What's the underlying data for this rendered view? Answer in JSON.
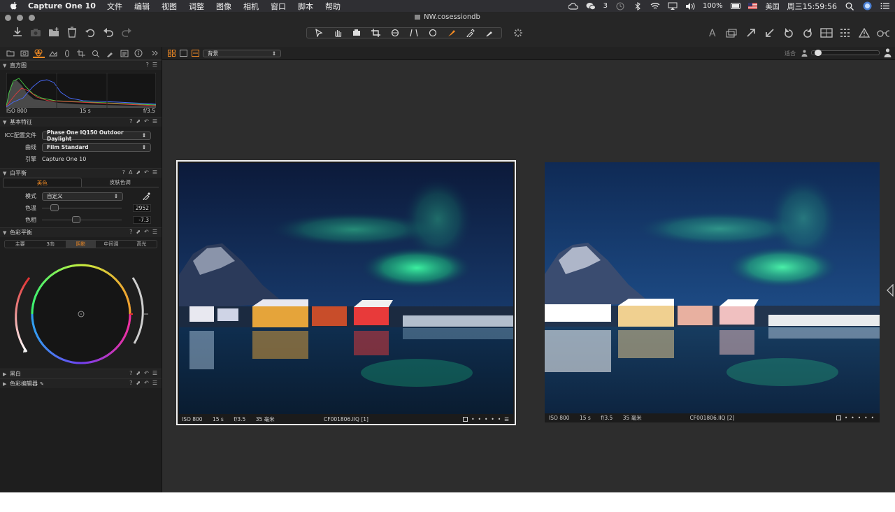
{
  "menubar": {
    "app_name": "Capture One 10",
    "menus": [
      "文件",
      "编辑",
      "视图",
      "调整",
      "图像",
      "相机",
      "窗口",
      "脚本",
      "帮助"
    ],
    "wechat_count": "3",
    "battery": "100%",
    "input_source": "美国",
    "datetime": "周三15:59:56"
  },
  "window": {
    "title": "NW.cosessiondb"
  },
  "viewer_bar": {
    "layout_select": "背景",
    "fit_label": "适合"
  },
  "histogram": {
    "title": "直方图",
    "iso": "ISO 800",
    "shutter": "15 s",
    "aperture": "f/3.5"
  },
  "basic": {
    "title": "基本特征",
    "icc_label": "ICC配置文件",
    "icc_value": "Phase One IQ150 Outdoor Daylight",
    "curve_label": "曲线",
    "curve_value": "Film Standard",
    "engine_label": "引擎",
    "engine_value": "Capture One 10"
  },
  "white_balance": {
    "title": "白平衡",
    "tabs": [
      "英色",
      "皮肤色调"
    ],
    "mode_label": "模式",
    "mode_value": "自定义",
    "kelvin_label": "色温",
    "kelvin_value": "2952",
    "tint_label": "色相",
    "tint_value": "-7.3"
  },
  "color_balance": {
    "title": "色彩平衡",
    "tabs": [
      "主要",
      "3向",
      "阴影",
      "中间调",
      "高光"
    ]
  },
  "bw": {
    "title": "黑白"
  },
  "color_editor": {
    "title": "色彩编辑器"
  },
  "photos": [
    {
      "iso": "ISO 800",
      "shutter": "15 s",
      "aperture": "f/3.5",
      "focal": "35 毫米",
      "filename": "CF001806.IIQ [1]"
    },
    {
      "iso": "ISO 800",
      "shutter": "15 s",
      "aperture": "f/3.5",
      "focal": "35 毫米",
      "filename": "CF001806.IIQ [2]"
    }
  ],
  "colors": {
    "accent": "#f08a24",
    "panel_bg": "#1e1e1e",
    "viewer_bg": "#2d2d2d"
  }
}
